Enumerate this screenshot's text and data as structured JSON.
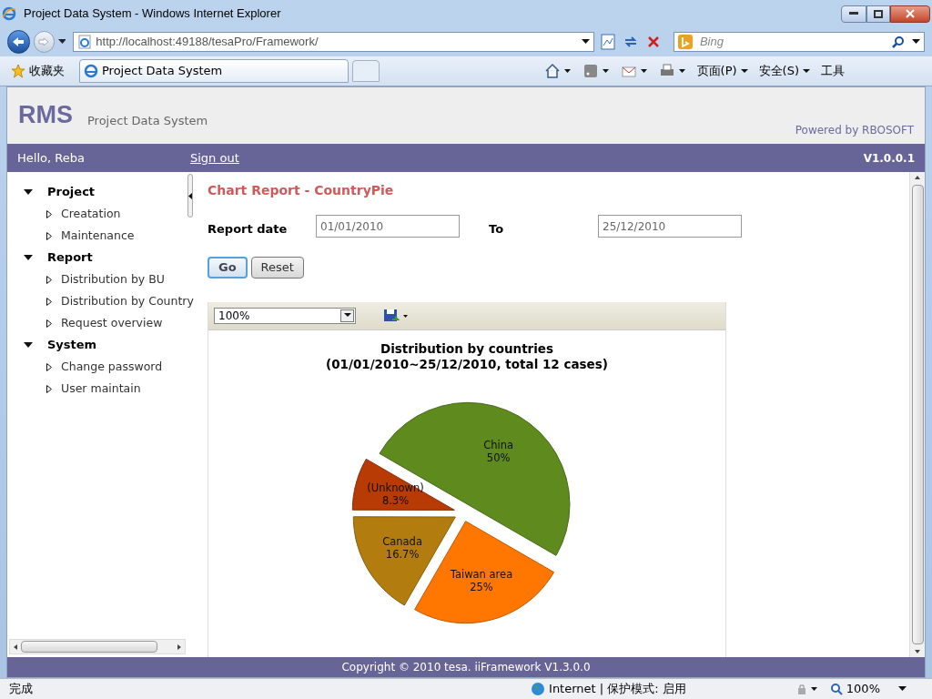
{
  "browser": {
    "title": "Project Data System - Windows Internet Explorer",
    "address": "http://localhost:49188/tesaPro/Framework/",
    "search_placeholder": "Bing",
    "favorites": "收藏夹",
    "tabs": [
      {
        "label": "Project Data System",
        "selected": true
      }
    ],
    "commands": [
      "页面(P)",
      "安全(S)",
      "工具"
    ]
  },
  "header": {
    "brand": "RMS",
    "subtitle": "Project Data System",
    "powered_by": "Powered by RBOSOFT"
  },
  "user_bar": {
    "greeting": "Hello, Reba",
    "sign_out": "Sign out",
    "version": "V1.0.0.1"
  },
  "sidebar": {
    "items": [
      {
        "label": "Project",
        "expanded": true,
        "children": [
          {
            "label": "Creatation"
          },
          {
            "label": "Maintenance"
          }
        ]
      },
      {
        "label": "Report",
        "expanded": true,
        "children": [
          {
            "label": "Distribution by BU"
          },
          {
            "label": "Distribution by Country"
          },
          {
            "label": "Request overview"
          }
        ]
      },
      {
        "label": "System",
        "expanded": true,
        "children": [
          {
            "label": "Change password"
          },
          {
            "label": "User maintain"
          }
        ]
      }
    ]
  },
  "report": {
    "title": "Chart Report - CountryPie",
    "from_label": "Report date",
    "from_value": "01/01/2010",
    "to_label": "To",
    "to_value": "25/12/2010",
    "buttons": [
      "Go",
      "Reset"
    ],
    "zoom": "100%",
    "chart_data": {
      "type": "pie",
      "title": "Distribution by countries\n(01/01/2010~25/12/2010, total 12 cases)",
      "categories": [
        "China",
        "Taiwan area",
        "Canada",
        "(Unknown)"
      ],
      "series": [
        {
          "values": [
            50,
            25,
            16.7,
            8.3
          ],
          "colors": [
            "#5f8a1e",
            "#ff7700",
            "#b27d0e",
            "#b83a05"
          ]
        }
      ],
      "value_labels": [
        "50%",
        "25%",
        "16.7%",
        "8.3%"
      ]
    }
  },
  "footer": "Copyright © 2010 tesa. iiFramework V1.3.0.0",
  "status_bar": {
    "text": "完成",
    "zone": "Internet | 保护模式: 启用",
    "zoom": "100%"
  }
}
